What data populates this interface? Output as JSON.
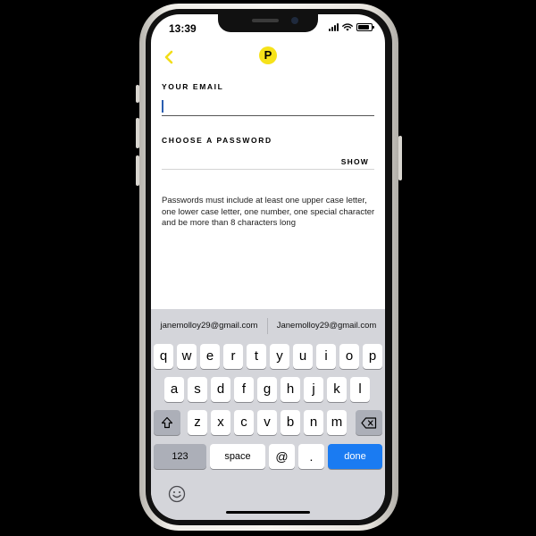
{
  "status_bar": {
    "time": "13:39"
  },
  "header": {
    "logo_letter": "P"
  },
  "form": {
    "email_label": "YOUR EMAIL",
    "email_value": "",
    "password_label": "CHOOSE A PASSWORD",
    "password_value": "",
    "show_label": "SHOW",
    "hint": "Passwords must include at least one upper case letter, one lower case letter, one number, one special character and be more than 8 characters long"
  },
  "keyboard": {
    "suggestions": [
      "janemolloy29@gmail.com",
      "Janemolloy29@gmail.com"
    ],
    "row1": [
      "q",
      "w",
      "e",
      "r",
      "t",
      "y",
      "u",
      "i",
      "o",
      "p"
    ],
    "row2": [
      "a",
      "s",
      "d",
      "f",
      "g",
      "h",
      "j",
      "k",
      "l"
    ],
    "row3": [
      "z",
      "x",
      "c",
      "v",
      "b",
      "n",
      "m"
    ],
    "numbers_label": "123",
    "space_label": "space",
    "at_label": "@",
    "dot_label": ".",
    "done_label": "done"
  },
  "colors": {
    "logo_yellow": "#f6e21a",
    "accent_blue": "#1a7bf2",
    "back_arrow": "#f2dd17"
  },
  "icons": [
    "chevron-left-icon",
    "signal-icon",
    "wifi-icon",
    "battery-icon",
    "shift-icon",
    "delete-icon",
    "emoji-icon"
  ]
}
